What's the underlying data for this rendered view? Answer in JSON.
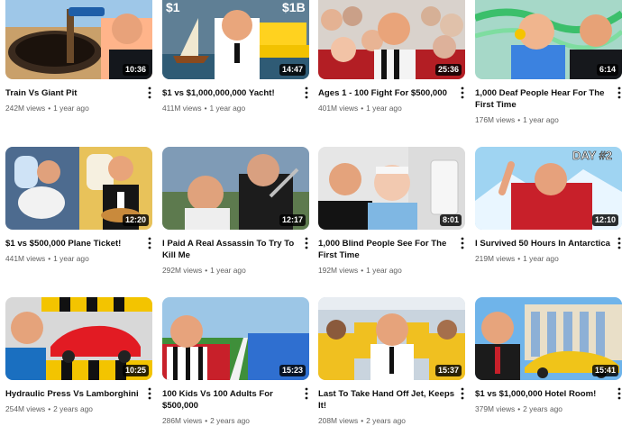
{
  "videos": [
    {
      "title": "Train Vs Giant Pit",
      "duration": "10:36",
      "views": "242M views",
      "age": "1 year ago"
    },
    {
      "title": "$1 vs $1,000,000,000 Yacht!",
      "duration": "14:47",
      "views": "411M views",
      "age": "1 year ago",
      "thumb_text_left": "$1",
      "thumb_text_right": "$1B"
    },
    {
      "title": "Ages 1 - 100 Fight For $500,000",
      "duration": "25:36",
      "views": "401M views",
      "age": "1 year ago"
    },
    {
      "title": "1,000 Deaf People Hear For The First Time",
      "duration": "6:14",
      "views": "176M views",
      "age": "1 year ago"
    },
    {
      "title": "$1 vs $500,000 Plane Ticket!",
      "duration": "12:20",
      "views": "441M views",
      "age": "1 year ago"
    },
    {
      "title": "I Paid A Real Assassin To Try To Kill Me",
      "duration": "12:17",
      "views": "292M views",
      "age": "1 year ago"
    },
    {
      "title": "1,000 Blind People See For The First Time",
      "duration": "8:01",
      "views": "192M views",
      "age": "1 year ago"
    },
    {
      "title": "I Survived 50 Hours In Antarctica",
      "duration": "12:10",
      "views": "219M views",
      "age": "1 year ago",
      "thumb_text_right": "DAY #2"
    },
    {
      "title": "Hydraulic Press Vs Lamborghini",
      "duration": "10:25",
      "views": "254M views",
      "age": "2 years ago"
    },
    {
      "title": "100 Kids Vs 100 Adults For $500,000",
      "duration": "15:23",
      "views": "286M views",
      "age": "2 years ago"
    },
    {
      "title": "Last To Take Hand Off Jet, Keeps It!",
      "duration": "15:37",
      "views": "208M views",
      "age": "2 years ago"
    },
    {
      "title": "$1 vs $1,000,000 Hotel Room!",
      "duration": "15:41",
      "views": "379M views",
      "age": "2 years ago"
    }
  ],
  "icons": {
    "more": "more-vert-icon"
  },
  "colors": {
    "duration_bg": "#000000",
    "title": "#0f0f0f",
    "meta": "#606060"
  }
}
